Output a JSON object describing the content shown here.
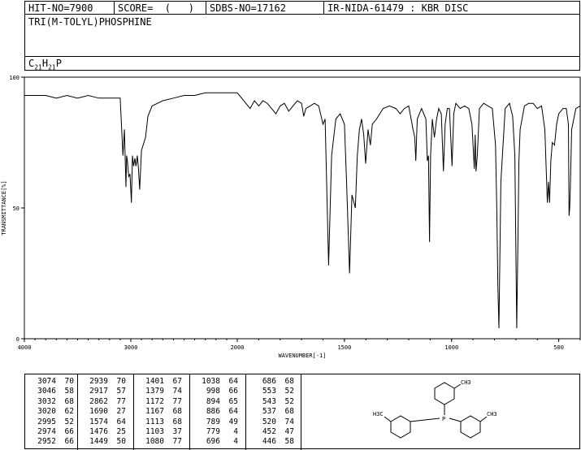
{
  "header": {
    "hit_no": "HIT-NO=7900",
    "score": "SCORE=  (   )",
    "sdbs_no": "SDBS-NO=17162",
    "ir_info": "IR-NIDA-61479 : KBR DISC"
  },
  "compound": {
    "name": "TRI(M-TOLYL)PHOSPHINE",
    "formula_parts": {
      "c": "C",
      "c_n": "21",
      "h": "H",
      "h_n": "21",
      "p": "P"
    }
  },
  "peak_table": [
    [
      [
        "3074",
        "70"
      ],
      [
        "3046",
        "58"
      ],
      [
        "3032",
        "68"
      ],
      [
        "3020",
        "62"
      ],
      [
        "2995",
        "52"
      ],
      [
        "2974",
        "66"
      ],
      [
        "2952",
        "66"
      ]
    ],
    [
      [
        "2939",
        "70"
      ],
      [
        "2917",
        "57"
      ],
      [
        "2862",
        "77"
      ],
      [
        "1690",
        "27"
      ],
      [
        "1574",
        "64"
      ],
      [
        "1476",
        "25"
      ],
      [
        "1449",
        "50"
      ]
    ],
    [
      [
        "1401",
        "67"
      ],
      [
        "1379",
        "74"
      ],
      [
        "1172",
        "77"
      ],
      [
        "1167",
        "68"
      ],
      [
        "1113",
        "68"
      ],
      [
        "1103",
        "37"
      ],
      [
        "1080",
        "77"
      ]
    ],
    [
      [
        "1038",
        "64"
      ],
      [
        "998",
        "66"
      ],
      [
        "894",
        "65"
      ],
      [
        "886",
        "64"
      ],
      [
        "789",
        "49"
      ],
      [
        "779",
        "4"
      ],
      [
        "696",
        "4"
      ]
    ],
    [
      [
        "686",
        "68"
      ],
      [
        "553",
        "52"
      ],
      [
        "543",
        "52"
      ],
      [
        "537",
        "68"
      ],
      [
        "520",
        "74"
      ],
      [
        "452",
        "47"
      ],
      [
        "446",
        "58"
      ]
    ]
  ],
  "structure_labels": {
    "ch3": "CH3",
    "h3c": "H3C",
    "p": "P"
  },
  "chart_data": {
    "type": "line",
    "xlabel": "WAVENUMBER[-1]",
    "ylabel": "TRANSMITTANCE[%]",
    "xlim": [
      4000,
      400
    ],
    "ylim": [
      0,
      100
    ],
    "x_ticks": [
      4000,
      3000,
      2000,
      1500,
      1000,
      500
    ],
    "y_ticks": [
      0,
      50,
      100
    ],
    "grid": false,
    "series": [
      {
        "x": [
          4000,
          3900,
          3800,
          3700,
          3600,
          3500,
          3400,
          3300,
          3200,
          3100,
          3074,
          3060,
          3046,
          3040,
          3032,
          3026,
          3020,
          3008,
          2995,
          2985,
          2974,
          2962,
          2952,
          2945,
          2939,
          2928,
          2917,
          2900,
          2862,
          2840,
          2800,
          2750,
          2700,
          2600,
          2500,
          2400,
          2300,
          2200,
          2100,
          2000,
          1960,
          1940,
          1920,
          1900,
          1880,
          1860,
          1840,
          1820,
          1800,
          1780,
          1760,
          1740,
          1720,
          1700,
          1690,
          1680,
          1660,
          1640,
          1620,
          1600,
          1590,
          1574,
          1560,
          1540,
          1520,
          1500,
          1490,
          1476,
          1465,
          1449,
          1440,
          1430,
          1420,
          1410,
          1401,
          1390,
          1379,
          1370,
          1350,
          1320,
          1290,
          1260,
          1240,
          1220,
          1200,
          1180,
          1172,
          1167,
          1160,
          1140,
          1120,
          1113,
          1108,
          1103,
          1098,
          1090,
          1080,
          1070,
          1060,
          1048,
          1038,
          1030,
          1020,
          1010,
          998,
          990,
          980,
          960,
          940,
          920,
          905,
          894,
          890,
          886,
          880,
          870,
          850,
          830,
          810,
          795,
          789,
          784,
          779,
          770,
          750,
          730,
          715,
          705,
          696,
          690,
          686,
          680,
          660,
          640,
          620,
          600,
          580,
          565,
          553,
          548,
          543,
          540,
          537,
          530,
          520,
          510,
          500,
          480,
          465,
          455,
          452,
          449,
          446,
          440,
          420,
          400
        ],
        "y": [
          93,
          93,
          93,
          92,
          93,
          92,
          93,
          92,
          92,
          92,
          70,
          80,
          58,
          70,
          68,
          65,
          62,
          63,
          52,
          70,
          66,
          69,
          66,
          68,
          70,
          65,
          57,
          72,
          77,
          85,
          89,
          90,
          91,
          92,
          93,
          93,
          94,
          94,
          94,
          94,
          90,
          88,
          91,
          89,
          91,
          90,
          88,
          86,
          89,
          90,
          87,
          89,
          91,
          90,
          85,
          88,
          89,
          90,
          89,
          82,
          84,
          28,
          70,
          84,
          86,
          82,
          60,
          25,
          55,
          50,
          70,
          80,
          84,
          78,
          67,
          80,
          74,
          82,
          84,
          88,
          89,
          88,
          86,
          88,
          89,
          80,
          77,
          68,
          84,
          88,
          84,
          68,
          70,
          37,
          70,
          84,
          77,
          84,
          88,
          86,
          64,
          82,
          88,
          88,
          66,
          86,
          90,
          88,
          89,
          88,
          82,
          65,
          78,
          64,
          70,
          88,
          90,
          89,
          88,
          74,
          49,
          20,
          4,
          60,
          88,
          90,
          85,
          70,
          4,
          40,
          68,
          80,
          89,
          90,
          90,
          88,
          89,
          80,
          52,
          60,
          52,
          60,
          68,
          75,
          74,
          82,
          86,
          88,
          88,
          82,
          47,
          50,
          58,
          80,
          88,
          89
        ]
      }
    ]
  }
}
